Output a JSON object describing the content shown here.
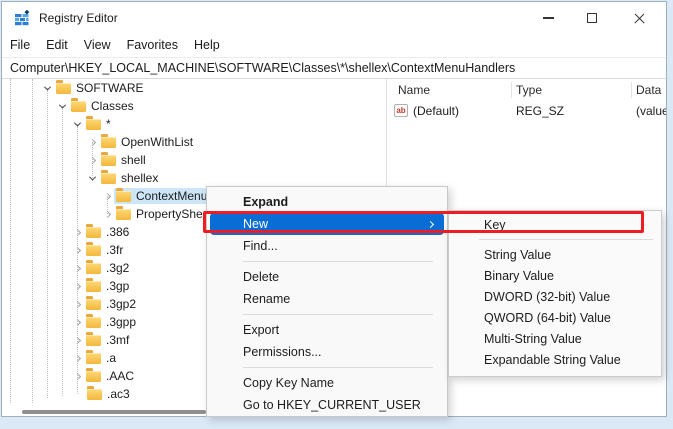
{
  "titlebar": {
    "title": "Registry Editor"
  },
  "menubar": {
    "items": [
      "File",
      "Edit",
      "View",
      "Favorites",
      "Help"
    ]
  },
  "addressbar": {
    "value": "Computer\\HKEY_LOCAL_MACHINE\\SOFTWARE\\Classes\\*\\shellex\\ContextMenuHandlers"
  },
  "tree": {
    "items": [
      {
        "label": "SOFTWARE"
      },
      {
        "label": "Classes"
      },
      {
        "label": "*"
      },
      {
        "label": "OpenWithList"
      },
      {
        "label": "shell"
      },
      {
        "label": "shellex"
      },
      {
        "label": "ContextMenuHandlers"
      },
      {
        "label": "PropertySheetHandlers"
      },
      {
        "label": ".386"
      },
      {
        "label": ".3fr"
      },
      {
        "label": ".3g2"
      },
      {
        "label": ".3gp"
      },
      {
        "label": ".3gp2"
      },
      {
        "label": ".3gpp"
      },
      {
        "label": ".3mf"
      },
      {
        "label": ".a"
      },
      {
        "label": ".AAC"
      },
      {
        "label": ".ac3"
      }
    ]
  },
  "list": {
    "columns": [
      "Name",
      "Type",
      "Data"
    ],
    "rows": [
      {
        "icon_label": "ab",
        "name": "(Default)",
        "type": "REG_SZ",
        "data": "(value not set)"
      }
    ]
  },
  "context_menu": {
    "items": [
      {
        "label": "Expand",
        "bold": true
      },
      {
        "label": "New",
        "highlighted": true,
        "has_submenu": true
      },
      {
        "label": "Find..."
      },
      {
        "label": "Delete"
      },
      {
        "label": "Rename"
      },
      {
        "label": "Export"
      },
      {
        "label": "Permissions..."
      },
      {
        "label": "Copy Key Name"
      },
      {
        "label": "Go to HKEY_CURRENT_USER"
      }
    ]
  },
  "submenu": {
    "items": [
      {
        "label": "Key"
      },
      {
        "label": "String Value"
      },
      {
        "label": "Binary Value"
      },
      {
        "label": "DWORD (32-bit) Value"
      },
      {
        "label": "QWORD (64-bit) Value"
      },
      {
        "label": "Multi-String Value"
      },
      {
        "label": "Expandable String Value"
      }
    ]
  },
  "colors": {
    "menu_highlight": "#0a6dd6",
    "tree_selection": "#cde6f7",
    "annotation_box": "#ee1d23",
    "folder_yellow": "#f2b73c"
  }
}
